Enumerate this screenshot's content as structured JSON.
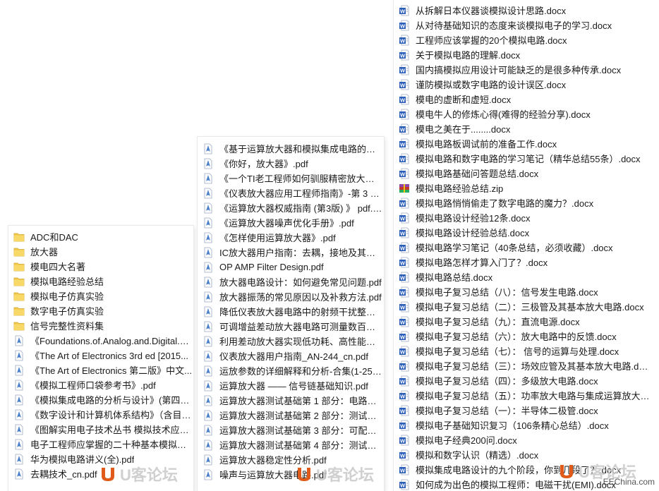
{
  "colors": {
    "folder": "#f2c94c",
    "pdf": "#4a7fc9",
    "doc": "#2b5eb8",
    "zip": "#c0392b",
    "watermark": "#e05a1a"
  },
  "left_panel": {
    "items": [
      {
        "type": "folder",
        "icon": "folder-icon",
        "label": "ADC和DAC"
      },
      {
        "type": "folder",
        "icon": "folder-icon",
        "label": "放大器"
      },
      {
        "type": "folder",
        "icon": "folder-icon",
        "label": "模电四大名著"
      },
      {
        "type": "folder",
        "icon": "folder-icon",
        "label": "模拟电路经验总结"
      },
      {
        "type": "folder",
        "icon": "folder-icon",
        "label": "模拟电子仿真实验"
      },
      {
        "type": "folder",
        "icon": "folder-icon",
        "label": "数字电子仿真实验"
      },
      {
        "type": "folder",
        "icon": "folder-icon",
        "label": "信号完整性资料集"
      },
      {
        "type": "pdf",
        "icon": "pdf-icon",
        "label": "《Foundations.of.Analog.and.Digital.E..."
      },
      {
        "type": "pdf",
        "icon": "pdf-icon",
        "label": "《The Art of Electronics 3rd ed [2015..."
      },
      {
        "type": "pdf",
        "icon": "pdf-icon",
        "label": "《The Art of Electronics 第二版》中文..."
      },
      {
        "type": "pdf",
        "icon": "pdf-icon",
        "label": "《模拟工程师口袋参考书》.pdf"
      },
      {
        "type": "pdf",
        "icon": "pdf-icon",
        "label": "《模拟集成电路的分析与设计》(第四版..."
      },
      {
        "type": "pdf",
        "icon": "pdf-icon",
        "label": "《数字设计和计算机体系结构》（含目录..."
      },
      {
        "type": "pdf",
        "icon": "pdf-icon",
        "label": "《图解实用电子技术丛书 模拟技术应用..."
      },
      {
        "type": "pdf",
        "icon": "pdf-icon",
        "label": "电子工程师应掌握的二十种基本模拟电路..."
      },
      {
        "type": "pdf",
        "icon": "pdf-icon",
        "label": "华为模拟电路讲义(全).pdf"
      },
      {
        "type": "pdf",
        "icon": "pdf-icon",
        "label": "去耦技术_cn.pdf"
      }
    ]
  },
  "mid_panel": {
    "items": [
      {
        "type": "pdf",
        "icon": "pdf-icon",
        "label": "《基于运算放大器和模拟集成电路的电路..."
      },
      {
        "type": "pdf",
        "icon": "pdf-icon",
        "label": "《你好，放大器》.pdf"
      },
      {
        "type": "pdf",
        "icon": "pdf-icon",
        "label": "《一个TI老工程师如何驯服精密放大器》..."
      },
      {
        "type": "pdf",
        "icon": "pdf-icon",
        "label": "《仪表放大器应用工程师指南》-第 3 版..."
      },
      {
        "type": "pdf",
        "icon": "pdf-icon",
        "label": "《运算放大器权威指南 (第3版) 》 pdf.pdf"
      },
      {
        "type": "pdf",
        "icon": "pdf-icon",
        "label": "《运算放大器噪声优化手册》.pdf"
      },
      {
        "type": "pdf",
        "icon": "pdf-icon",
        "label": "《怎样使用运算放大器》.pdf"
      },
      {
        "type": "pdf",
        "icon": "pdf-icon",
        "label": "IC放大器用户指南：去耦，接地及其他一..."
      },
      {
        "type": "pdf",
        "icon": "pdf-icon",
        "label": "OP AMP Filter Design.pdf"
      },
      {
        "type": "pdf",
        "icon": "pdf-icon",
        "label": "放大器电路设计：如何避免常见问题.pdf"
      },
      {
        "type": "pdf",
        "icon": "pdf-icon",
        "label": "放大器振荡的常见原因以及补救方法.pdf"
      },
      {
        "type": "pdf",
        "icon": "pdf-icon",
        "label": "降低仪表放大器电路中的射频干扰整流误..."
      },
      {
        "type": "pdf",
        "icon": "pdf-icon",
        "label": "可调增益差动放大器电路可测量数百伏电..."
      },
      {
        "type": "pdf",
        "icon": "pdf-icon",
        "label": "利用差动放大器实现低功耗、高性能绝对..."
      },
      {
        "type": "pdf",
        "icon": "pdf-icon",
        "label": "仪表放大器用户指南_AN-244_cn.pdf"
      },
      {
        "type": "pdf",
        "icon": "pdf-icon",
        "label": "运放参数的详细解释和分析-合集(1-25)...."
      },
      {
        "type": "pdf",
        "icon": "pdf-icon",
        "label": "运算放大器 —— 信号链基础知识.pdf"
      },
      {
        "type": "pdf",
        "icon": "pdf-icon",
        "label": "运算放大器测试基础第 1 部分：电路测..."
      },
      {
        "type": "pdf",
        "icon": "pdf-icon",
        "label": "运算放大器测试基础第 2 部分：测试运..."
      },
      {
        "type": "pdf",
        "icon": "pdf-icon",
        "label": "运算放大器测试基础第 3 部分：可配置..."
      },
      {
        "type": "pdf",
        "icon": "pdf-icon",
        "label": "运算放大器测试基础第 4 部分：测试运..."
      },
      {
        "type": "pdf",
        "icon": "pdf-icon",
        "label": "运算放大器稳定性分析.pdf"
      },
      {
        "type": "pdf",
        "icon": "pdf-icon",
        "label": "噪声与运算放大器电路.pdf"
      }
    ]
  },
  "right_panel": {
    "items": [
      {
        "type": "doc",
        "icon": "word-doc-icon",
        "label": "从拆解日本仪器谈模拟设计思路.docx"
      },
      {
        "type": "doc",
        "icon": "word-doc-icon",
        "label": "从对待基础知识的态度来谈模拟电子的学习.docx"
      },
      {
        "type": "doc",
        "icon": "word-doc-icon",
        "label": "工程师应该掌握的20个模拟电路.docx"
      },
      {
        "type": "doc",
        "icon": "word-doc-icon",
        "label": "关于模拟电路的理解.docx"
      },
      {
        "type": "doc",
        "icon": "word-doc-icon",
        "label": "国内搞模拟应用设计可能缺乏的是很多种传承.docx"
      },
      {
        "type": "doc",
        "icon": "word-doc-icon",
        "label": "谨防模拟或数字电路的设计误区.docx"
      },
      {
        "type": "doc",
        "icon": "word-doc-icon",
        "label": "模电的虚断和虚短.docx"
      },
      {
        "type": "doc",
        "icon": "word-doc-icon",
        "label": "模电牛人的修炼心得(难得的经验分享).docx"
      },
      {
        "type": "doc",
        "icon": "word-doc-icon",
        "label": "模电之美在于........docx"
      },
      {
        "type": "doc",
        "icon": "word-doc-icon",
        "label": "模拟电路板调试前的准备工作.docx"
      },
      {
        "type": "doc",
        "icon": "word-doc-icon",
        "label": "模拟电路和数字电路的学习笔记（精华总结55条）.docx"
      },
      {
        "type": "doc",
        "icon": "word-doc-icon",
        "label": "模拟电路基础问答题总结.docx"
      },
      {
        "type": "zip",
        "icon": "zip-archive-icon",
        "label": "模拟电路经验总结.zip"
      },
      {
        "type": "doc",
        "icon": "word-doc-icon",
        "label": "模拟电路悄悄偷走了数字电路的魔力？.docx"
      },
      {
        "type": "doc",
        "icon": "word-doc-icon",
        "label": "模拟电路设计经验12条.docx"
      },
      {
        "type": "doc",
        "icon": "word-doc-icon",
        "label": "模拟电路设计经验总结.docx"
      },
      {
        "type": "doc",
        "icon": "word-doc-icon",
        "label": "模拟电路学习笔记（40条总结，必须收藏）.docx"
      },
      {
        "type": "doc",
        "icon": "word-doc-icon",
        "label": "模拟电路怎样才算入门了？.docx"
      },
      {
        "type": "doc",
        "icon": "word-doc-icon",
        "label": "模拟电路总结.docx"
      },
      {
        "type": "doc",
        "icon": "word-doc-icon",
        "label": "模拟电子复习总结（八）：信号发生电路.docx"
      },
      {
        "type": "doc",
        "icon": "word-doc-icon",
        "label": "模拟电子复习总结（二）：三极管及其基本放大电路.docx"
      },
      {
        "type": "doc",
        "icon": "word-doc-icon",
        "label": "模拟电子复习总结（九）：直流电源.docx"
      },
      {
        "type": "doc",
        "icon": "word-doc-icon",
        "label": "模拟电子复习总结（六）：放大电路中的反馈.docx"
      },
      {
        "type": "doc",
        "icon": "word-doc-icon",
        "label": "模拟电子复习总结（七）： 信号的运算与处理.docx"
      },
      {
        "type": "doc",
        "icon": "word-doc-icon",
        "label": "模拟电子复习总结（三）：场效应管及其基本放大电路.docx"
      },
      {
        "type": "doc",
        "icon": "word-doc-icon",
        "label": "模拟电子复习总结（四）：多级放大电路.docx"
      },
      {
        "type": "doc",
        "icon": "word-doc-icon",
        "label": "模拟电子复习总结（五）：功率放大电路与集成运算放大电路.d"
      },
      {
        "type": "doc",
        "icon": "word-doc-icon",
        "label": "模拟电子复习总结（一）：半导体二极管.docx"
      },
      {
        "type": "doc",
        "icon": "word-doc-icon",
        "label": "模拟电子基础知识复习（106条精心总结）.docx"
      },
      {
        "type": "doc",
        "icon": "word-doc-icon",
        "label": "模拟电子经典200问.docx"
      },
      {
        "type": "doc",
        "icon": "word-doc-icon",
        "label": "模拟和数字认识（精选）.docx"
      },
      {
        "type": "doc",
        "icon": "word-doc-icon",
        "label": "模拟集成电路设计的九个阶段，你到几段了？.docx"
      },
      {
        "type": "doc",
        "icon": "word-doc-icon",
        "label": "如何成为出色的模拟工程师：电磁干扰(EMI).docx"
      }
    ]
  },
  "watermark": {
    "text": "U客论坛"
  },
  "site_tag": "EEChina.com"
}
